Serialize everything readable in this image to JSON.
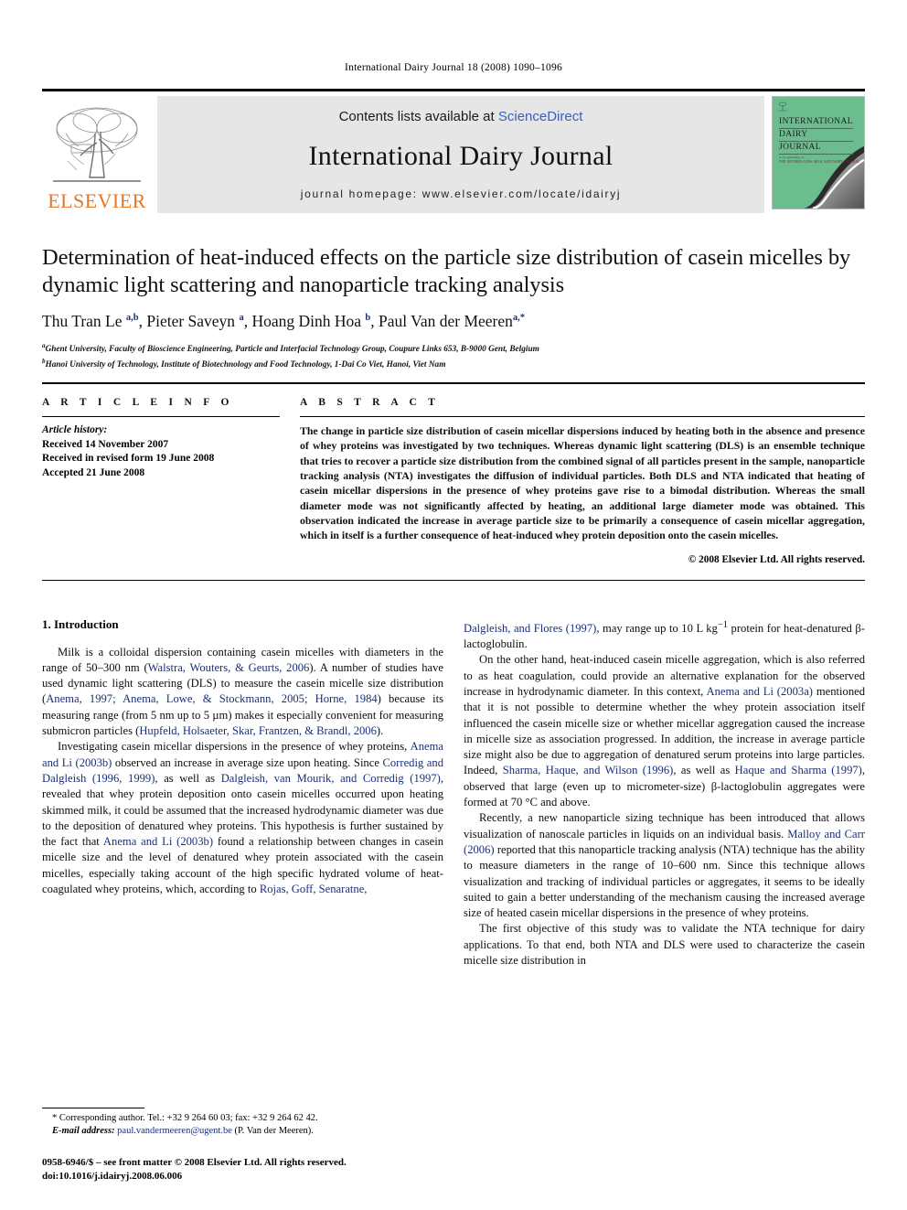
{
  "running_head": "International Dairy Journal 18 (2008) 1090–1096",
  "masthead": {
    "elsevier_wordmark": "ELSEVIER",
    "contents_prefix": "Contents lists available at ",
    "sciencedirect": "ScienceDirect",
    "journal_name": "International Dairy Journal",
    "homepage": "journal homepage: www.elsevier.com/locate/idairyj",
    "cover": {
      "line1": "INTERNATIONAL",
      "line2": "DAIRY",
      "line3": "JOURNAL",
      "sub_label": "A co-operating of",
      "sub_body": "THE NETHERLANDS MILK AND DAIRY JOURNAL"
    }
  },
  "article": {
    "title": "Determination of heat-induced effects on the particle size distribution of casein micelles by dynamic light scattering and nanoparticle tracking analysis",
    "authors_html": "Thu Tran Le <sup>a,b</sup>, Pieter Saveyn <sup>a</sup>, Hoang Dinh Hoa <sup>b</sup>, Paul Van der Meeren<sup>a,*</sup>",
    "affiliations": [
      {
        "marker": "a",
        "text": "Ghent University, Faculty of Bioscience Engineering, Particle and Interfacial Technology Group, Coupure Links 653, B-9000 Gent, Belgium"
      },
      {
        "marker": "b",
        "text": "Hanoi University of Technology, Institute of Biotechnology and Food Technology, 1-Dai Co Viet, Hanoi, Viet Nam"
      }
    ]
  },
  "article_info": {
    "heading": "A R T I C L E   I N F O",
    "history_label": "Article history:",
    "history": [
      "Received 14 November 2007",
      "Received in revised form 19 June 2008",
      "Accepted 21 June 2008"
    ]
  },
  "abstract": {
    "heading": "A B S T R A C T",
    "text": "The change in particle size distribution of casein micellar dispersions induced by heating both in the absence and presence of whey proteins was investigated by two techniques. Whereas dynamic light scattering (DLS) is an ensemble technique that tries to recover a particle size distribution from the combined signal of all particles present in the sample, nanoparticle tracking analysis (NTA) investigates the diffusion of individual particles. Both DLS and NTA indicated that heating of casein micellar dispersions in the presence of whey proteins gave rise to a bimodal distribution. Whereas the small diameter mode was not significantly affected by heating, an additional large diameter mode was obtained. This observation indicated the increase in average particle size to be primarily a consequence of casein micellar aggregation, which in itself is a further consequence of heat-induced whey protein deposition onto the casein micelles.",
    "copyright": "© 2008 Elsevier Ltd. All rights reserved."
  },
  "body": {
    "section_heading": "1. Introduction",
    "left_paragraphs": [
      "Milk is a colloidal dispersion containing casein micelles with diameters in the range of 50–300 nm (<span class=\"cite\">Walstra, Wouters, &amp; Geurts, 2006</span>). A number of studies have used dynamic light scattering (DLS) to measure the casein micelle size distribution (<span class=\"cite\">Anema, 1997; Anema, Lowe, &amp; Stockmann, 2005; Horne, 1984</span>) because its measuring range (from 5 nm up to 5 µm) makes it especially convenient for measuring submicron particles (<span class=\"cite\">Hupfeld, Holsaeter, Skar, Frantzen, &amp; Brandl, 2006</span>).",
      "Investigating casein micellar dispersions in the presence of whey proteins, <span class=\"cite\">Anema and Li (2003b)</span> observed an increase in average size upon heating. Since <span class=\"cite\">Corredig and Dalgleish (1996, 1999)</span>, as well as <span class=\"cite\">Dalgleish, van Mourik, and Corredig (1997)</span>, revealed that whey protein deposition onto casein micelles occurred upon heating skimmed milk, it could be assumed that the increased hydrodynamic diameter was due to the deposition of denatured whey proteins. This hypothesis is further sustained by the fact that <span class=\"cite\">Anema and Li (2003b)</span> found a relationship between changes in casein micelle size and the level of denatured whey protein associated with the casein micelles, especially taking account of the high specific hydrated volume of heat-coagulated whey proteins, which, according to <span class=\"cite\">Rojas, Goff, Senaratne,</span>"
    ],
    "right_paragraphs": [
      "<span class=\"cite\">Dalgleish, and Flores (1997)</span>, may range up to 10 L kg<sup>−1</sup> protein for heat-denatured β-lactoglobulin.",
      "On the other hand, heat-induced casein micelle aggregation, which is also referred to as heat coagulation, could provide an alternative explanation for the observed increase in hydrodynamic diameter. In this context, <span class=\"cite\">Anema and Li (2003a)</span> mentioned that it is not possible to determine whether the whey protein association itself influenced the casein micelle size or whether micellar aggregation caused the increase in micelle size as association progressed. In addition, the increase in average particle size might also be due to aggregation of denatured serum proteins into large particles. Indeed, <span class=\"cite\">Sharma, Haque, and Wilson (1996)</span>, as well as <span class=\"cite\">Haque and Sharma (1997)</span>, observed that large (even up to micrometer-size) β-lactoglobulin aggregates were formed at 70 °C and above.",
      "Recently, a new nanoparticle sizing technique has been introduced that allows visualization of nanoscale particles in liquids on an individual basis. <span class=\"cite\">Malloy and Carr (2006)</span> reported that this nanoparticle tracking analysis (NTA) technique has the ability to measure diameters in the range of 10–600 nm. Since this technique allows visualization and tracking of individual particles or aggregates, it seems to be ideally suited to gain a better understanding of the mechanism causing the increased average size of heated casein micellar dispersions in the presence of whey proteins.",
      "The first objective of this study was to validate the NTA technique for dairy applications. To that end, both NTA and DLS were used to characterize the casein micelle size distribution in"
    ]
  },
  "footnote": {
    "corresponding": "* Corresponding author. Tel.: +32 9 264 60 03; fax: +32 9 264 62 42.",
    "email_label": "E-mail address:",
    "email": "paul.vandermeeren@ugent.be",
    "email_owner": "(P. Van der Meeren).",
    "issn_line": "0958-6946/$ – see front matter © 2008 Elsevier Ltd. All rights reserved.",
    "doi_line": "doi:10.1016/j.idairyj.2008.06.006"
  },
  "colors": {
    "link_blue": "#3b5fc0",
    "citation_blue": "#1a2f7a",
    "elsevier_orange": "#e87722",
    "masthead_grey": "#e6e6e6",
    "cover_green": "#6bbd8f"
  }
}
